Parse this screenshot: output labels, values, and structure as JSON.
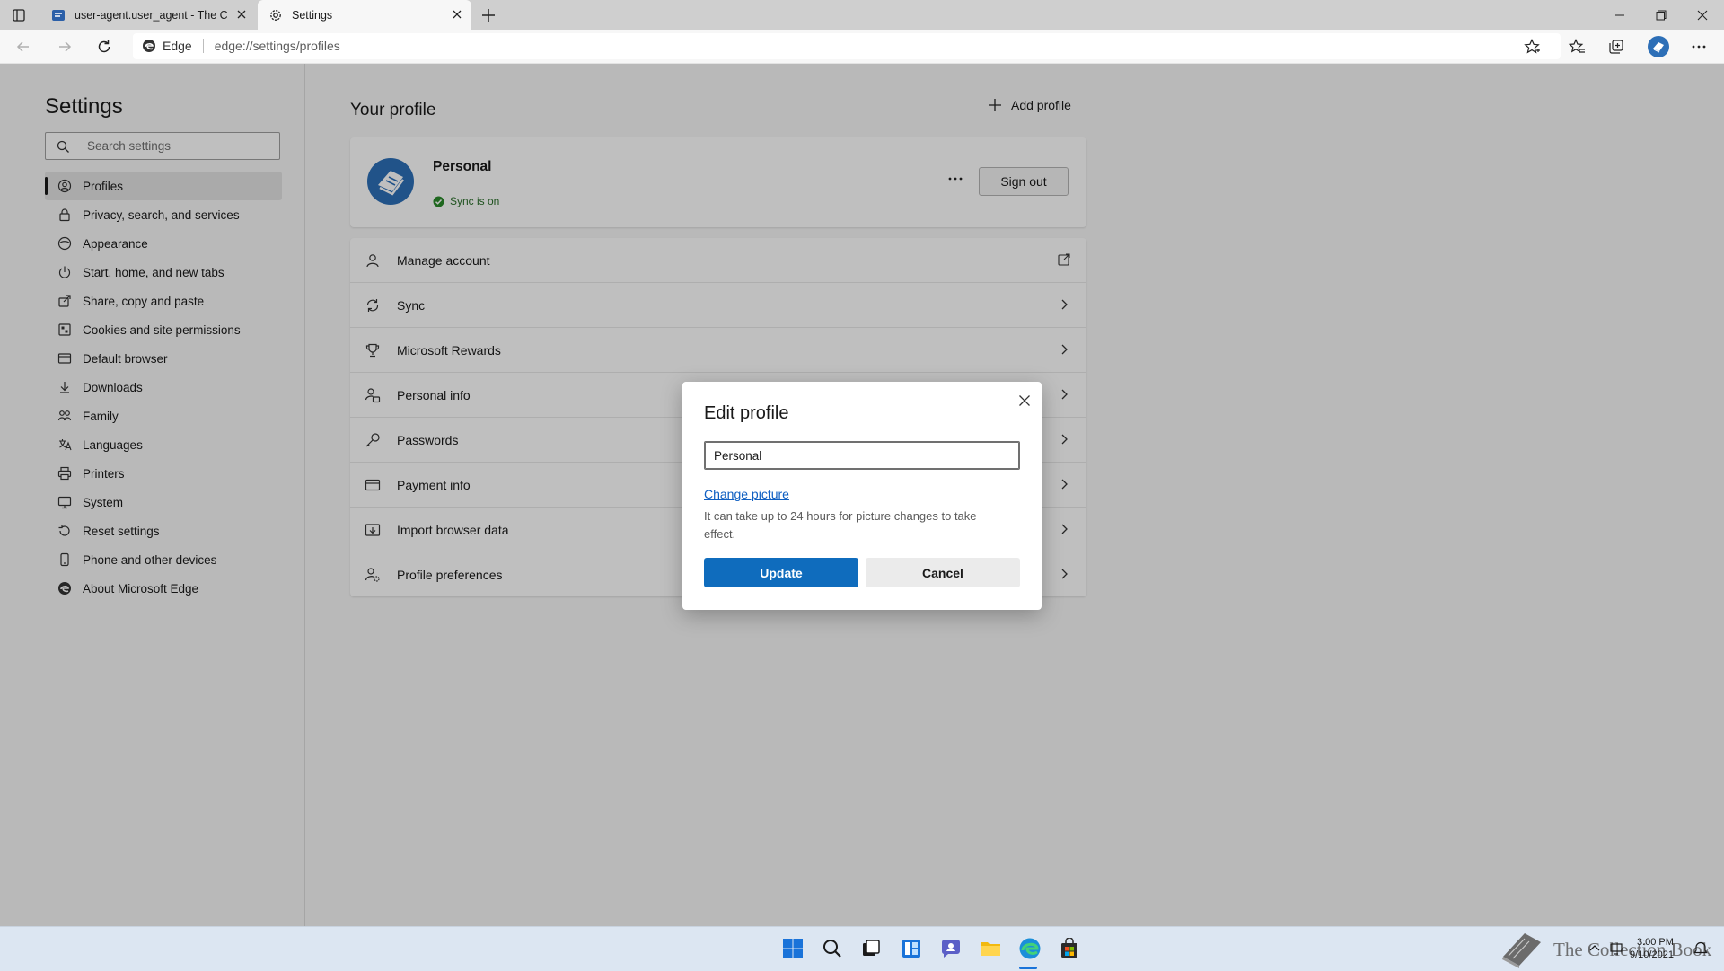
{
  "browser": {
    "tabs": [
      {
        "title": "user-agent.user_agent - The Coll"
      },
      {
        "title": "Settings"
      }
    ],
    "site_identity": "Edge",
    "url": "edge://settings/profiles"
  },
  "sidebar": {
    "title": "Settings",
    "search_placeholder": "Search settings",
    "items": [
      {
        "label": "Profiles",
        "icon": "profile-icon"
      },
      {
        "label": "Privacy, search, and services",
        "icon": "lock-icon"
      },
      {
        "label": "Appearance",
        "icon": "appearance-icon"
      },
      {
        "label": "Start, home, and new tabs",
        "icon": "power-icon"
      },
      {
        "label": "Share, copy and paste",
        "icon": "share-icon"
      },
      {
        "label": "Cookies and site permissions",
        "icon": "cookies-icon"
      },
      {
        "label": "Default browser",
        "icon": "browser-icon"
      },
      {
        "label": "Downloads",
        "icon": "download-icon"
      },
      {
        "label": "Family",
        "icon": "family-icon"
      },
      {
        "label": "Languages",
        "icon": "languages-icon"
      },
      {
        "label": "Printers",
        "icon": "printer-icon"
      },
      {
        "label": "System",
        "icon": "system-icon"
      },
      {
        "label": "Reset settings",
        "icon": "reset-icon"
      },
      {
        "label": "Phone and other devices",
        "icon": "phone-icon"
      },
      {
        "label": "About Microsoft Edge",
        "icon": "edge-icon"
      }
    ]
  },
  "main": {
    "heading": "Your profile",
    "add_profile": "Add profile",
    "profile": {
      "name": "Personal",
      "sync_status": "Sync is on",
      "sign_out": "Sign out"
    },
    "rows": [
      {
        "label": "Manage account",
        "icon": "person-icon"
      },
      {
        "label": "Sync",
        "icon": "sync-icon"
      },
      {
        "label": "Microsoft Rewards",
        "icon": "trophy-icon"
      },
      {
        "label": "Personal info",
        "icon": "personal-info-icon"
      },
      {
        "label": "Passwords",
        "icon": "key-icon"
      },
      {
        "label": "Payment info",
        "icon": "card-icon"
      },
      {
        "label": "Import browser data",
        "icon": "import-icon"
      },
      {
        "label": "Profile preferences",
        "icon": "profile-prefs-icon"
      }
    ]
  },
  "dialog": {
    "title": "Edit profile",
    "name_value": "Personal",
    "change_picture": "Change picture",
    "note": "It can take up to 24 hours for picture changes to take effect.",
    "update": "Update",
    "cancel": "Cancel"
  },
  "taskbar": {
    "time": "3:00 PM",
    "date": "9/10/2021",
    "watermark": "The Collection Book"
  },
  "colors": {
    "accent": "#0f6cbd",
    "link": "#0f5fc2",
    "sync_ok": "#2a8a2a"
  }
}
